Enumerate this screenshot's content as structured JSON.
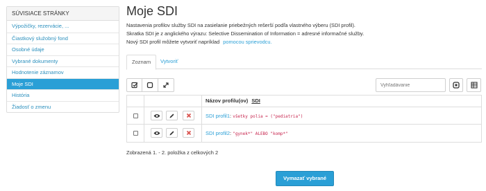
{
  "sidebar": {
    "heading": "SÚVISIACE STRÁNKY",
    "items": [
      {
        "label": "Výpožičky, rezervácie, ..."
      },
      {
        "label": "Čiastkový služobný fond"
      },
      {
        "label": "Osobné údaje"
      },
      {
        "label": "Vybrané dokumenty"
      },
      {
        "label": "Hodnotenie záznamov"
      },
      {
        "label": "Moje SDI"
      },
      {
        "label": "História"
      },
      {
        "label": "Žiadosť o zmenu"
      }
    ]
  },
  "page": {
    "title": "Moje SDI",
    "description_line1": "Nastavenia profilov služby SDI na zasielanie priebežných rešerší podľa vlastného výberu (SDI profil).",
    "description_line2": "Skratka SDI je z anglického výrazu: Selective Dissemination of Information = adresné informačné služby.",
    "description_line3": "Nový SDI profil môžete vytvoriť napríklad",
    "wizard_link": "pomocou sprievodcu."
  },
  "tabs": [
    {
      "label": "Zoznam"
    },
    {
      "label": "Vytvoriť"
    }
  ],
  "search": {
    "placeholder": "Vyhľadávanie"
  },
  "table": {
    "header": {
      "name_label": "Názov profilu(ov)",
      "sdi_label": "SDI"
    },
    "rows": [
      {
        "name": "SDI profil1",
        "query": "všetky polia = (\"pediatria\")"
      },
      {
        "name": "SDI profil2",
        "query": "\"gynek*\" ALEBO \"komp*\""
      }
    ]
  },
  "summary": "Zobrazená 1. - 2. položka z celkových 2",
  "delete_button": "Vymazať vybrané",
  "colors": {
    "accent": "#2a9fd6",
    "code": "#c7254e",
    "delete": "#d9534f"
  }
}
